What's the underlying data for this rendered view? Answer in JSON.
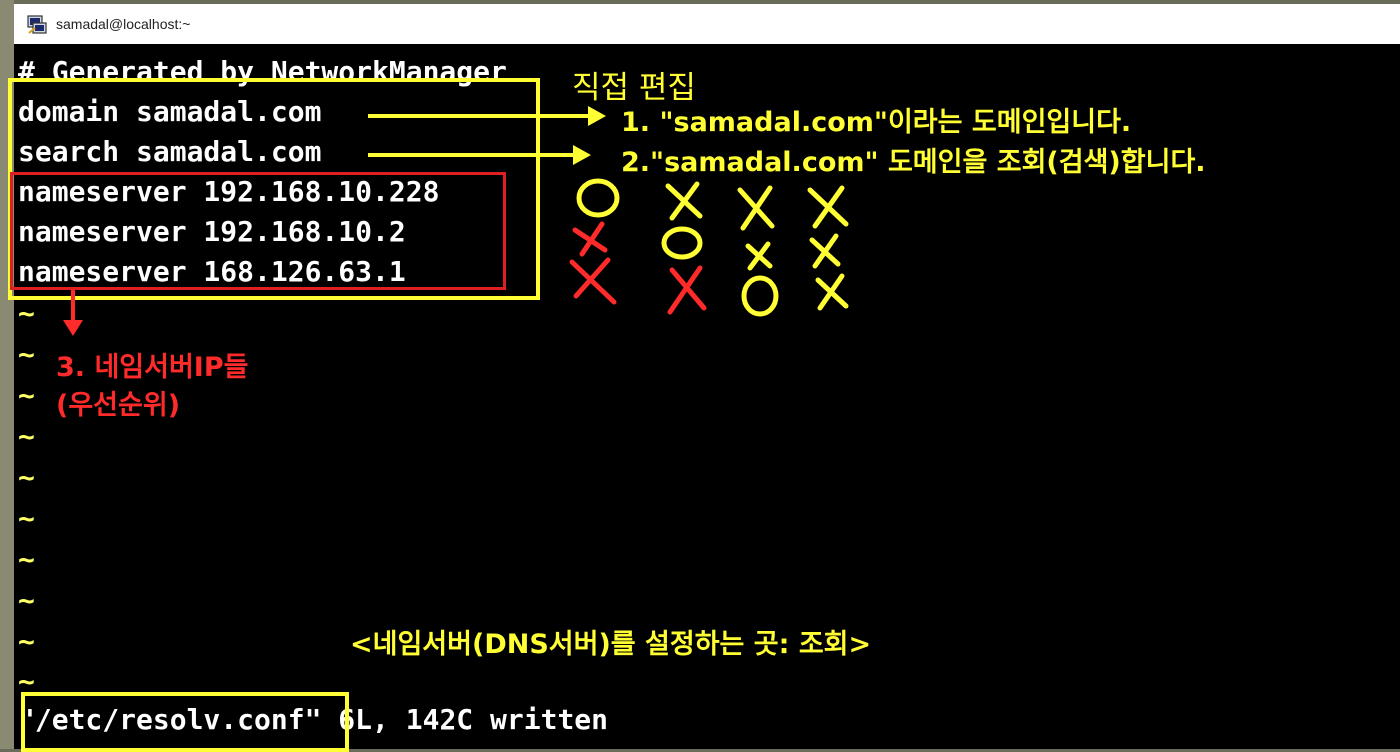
{
  "window": {
    "title": "samadal@localhost:~"
  },
  "file_lines": [
    "# Generated by NetworkManager",
    "domain samadal.com",
    "search samadal.com",
    "nameserver 192.168.10.228",
    "nameserver 192.168.10.2",
    "nameserver 168.126.63.1"
  ],
  "tilde": "~",
  "status_line": {
    "filename": "\"/etc/resolv.conf\"",
    "info": " 6L, 142C written"
  },
  "annotations": {
    "direct_edit": "직접 편집",
    "note1": "1. \"samadal.com\"이라는 도메인입니다.",
    "note2": "2.\"samadal.com\" 도메인을 조회(검색)합니다.",
    "note3_line1": "3. 네임서버IP들",
    "note3_line2": "(우선순위)",
    "footer": "<네임서버(DNS서버)를 설정하는 곳: 조회>"
  },
  "colors": {
    "annotation_yellow": "#ffff33",
    "annotation_red": "#ff2a2a",
    "terminal_bg": "#000000",
    "terminal_fg": "#ffffff"
  }
}
